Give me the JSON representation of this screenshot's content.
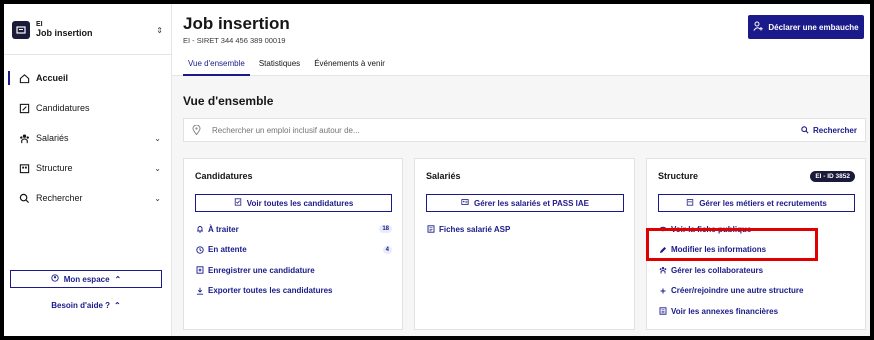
{
  "sidebar": {
    "org_kind": "EI",
    "org_name": "Job insertion",
    "org_toggle": "⇕",
    "nav": [
      {
        "label": "Accueil",
        "icon": "home-icon",
        "active": true,
        "chevron": ""
      },
      {
        "label": "Candidatures",
        "icon": "edit-box-icon",
        "active": false,
        "chevron": ""
      },
      {
        "label": "Salariés",
        "icon": "team-icon",
        "active": false,
        "chevron": "⌄"
      },
      {
        "label": "Structure",
        "icon": "building-icon",
        "active": false,
        "chevron": "⌄"
      },
      {
        "label": "Rechercher",
        "icon": "search-icon",
        "active": false,
        "chevron": "⌄"
      }
    ],
    "space_label": "Mon espace",
    "space_chevron": "⌃",
    "help_label": "Besoin d'aide ?",
    "help_chevron": "⌃"
  },
  "header": {
    "title": "Job insertion",
    "siret": "EI - SIRET 344 456 389 00019",
    "declare_label": "Déclarer une embauche",
    "tabs": [
      "Vue d'ensemble",
      "Statistiques",
      "Événements à venir"
    ]
  },
  "main": {
    "section_title": "Vue d'ensemble",
    "search_placeholder": "Rechercher un emploi inclusif autour de...",
    "search_button": "Rechercher",
    "cards": {
      "candidatures": {
        "title": "Candidatures",
        "button": "Voir toutes les candidatures",
        "links": [
          {
            "label": "À traiter",
            "icon": "bell-icon",
            "count": "18"
          },
          {
            "label": "En attente",
            "icon": "clock-icon",
            "count": "4"
          },
          {
            "label": "Enregistrer une candidature",
            "icon": "file-add-icon",
            "count": ""
          },
          {
            "label": "Exporter toutes les candidatures",
            "icon": "download-icon",
            "count": ""
          }
        ]
      },
      "salaries": {
        "title": "Salariés",
        "button": "Gérer les salariés et PASS IAE",
        "links": [
          {
            "label": "Fiches salarié ASP",
            "icon": "file-list-icon",
            "count": ""
          }
        ]
      },
      "structure": {
        "title": "Structure",
        "badge": "EI - ID 3852",
        "button": "Gérer les métiers et recrutements",
        "links": [
          {
            "label": "Voir la fiche publique",
            "icon": "eye-icon",
            "count": ""
          },
          {
            "label": "Modifier les informations",
            "icon": "pencil-icon",
            "count": ""
          },
          {
            "label": "Gérer les collaborateurs",
            "icon": "team-icon",
            "count": ""
          },
          {
            "label": "Créer/rejoindre une autre structure",
            "icon": "plus-icon",
            "count": ""
          },
          {
            "label": "Voir les annexes financières",
            "icon": "file-text-icon",
            "count": ""
          }
        ]
      }
    }
  },
  "colors": {
    "primary": "#1a1a8a",
    "dark": "#1a1a3a",
    "highlight": "#e00000",
    "background": "#f6f6f6"
  }
}
